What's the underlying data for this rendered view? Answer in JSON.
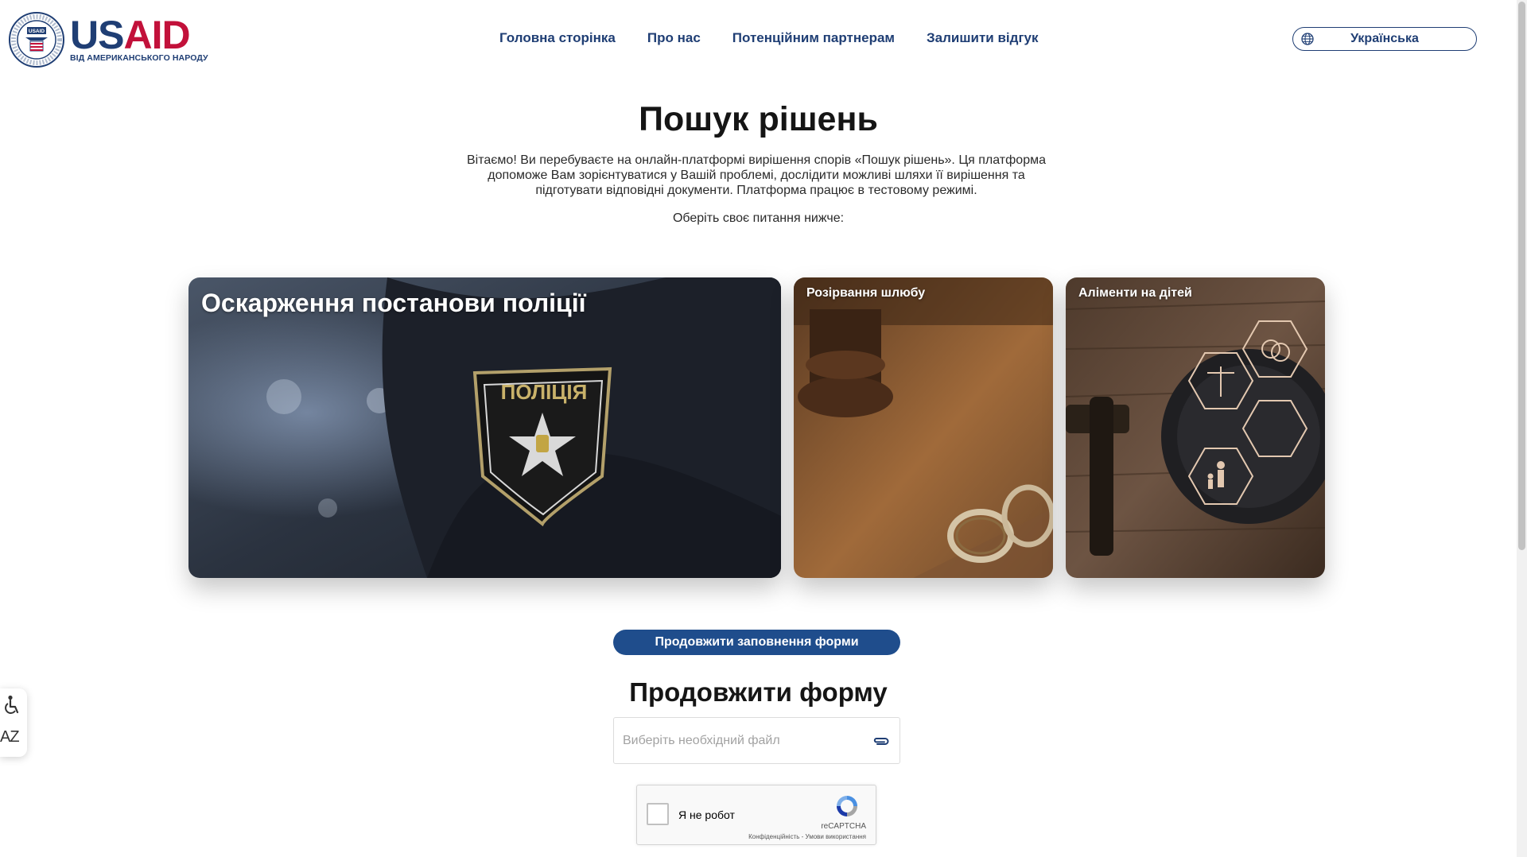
{
  "brand": {
    "name_part1": "US",
    "name_part2": "AID",
    "tagline": "ВІД АМЕРИКАНСЬКОГО НАРОДУ",
    "seal_top_text": "UNITED STATES AGENCY",
    "seal_bottom_text": "INTERNATIONAL DEVELOPMENT",
    "seal_center_text": "USAID",
    "colors": {
      "primary": "#1f3e74",
      "accent": "#c2113a"
    }
  },
  "nav": {
    "items": [
      {
        "label": "Головна сторінка"
      },
      {
        "label": "Про нас"
      },
      {
        "label": "Потенційним партнерам"
      },
      {
        "label": "Залишити відгук"
      }
    ]
  },
  "language": {
    "icon": "globe-icon",
    "selected": "Українська"
  },
  "hero": {
    "title": "Пошук рішень",
    "intro": "Вітаємо! Ви перебуваєте на онлайн-платформі вирішення спорів «Пошук рішень». Ця платформа допоможе Вам зорієнтуватися у Вашій проблемі, дослідити можливі шляхи її вирішення та підготувати відповідні документи. Платформа працює в тестовому режимі.",
    "prompt": "Оберіть своє питання нижче:"
  },
  "cards": [
    {
      "title": "Оскарження постанови поліції",
      "patch_text": "ПОЛІЦІЯ"
    },
    {
      "title": "Розірвання шлюбу"
    },
    {
      "title": "Аліменти на дітей"
    }
  ],
  "continue_form": {
    "button_label": "Продовжити заповнення форми",
    "title": "Продовжити форму",
    "file_placeholder": "Виберіть необхідний файл",
    "file_icon": "paperclip-icon"
  },
  "captcha": {
    "label": "Я не робот",
    "brand": "reCAPTCHA",
    "links": "Конфіденційність - Умови використання"
  },
  "accessibility": {
    "wheelchair_icon": "wheelchair-icon",
    "text_size_label": "AZ"
  }
}
